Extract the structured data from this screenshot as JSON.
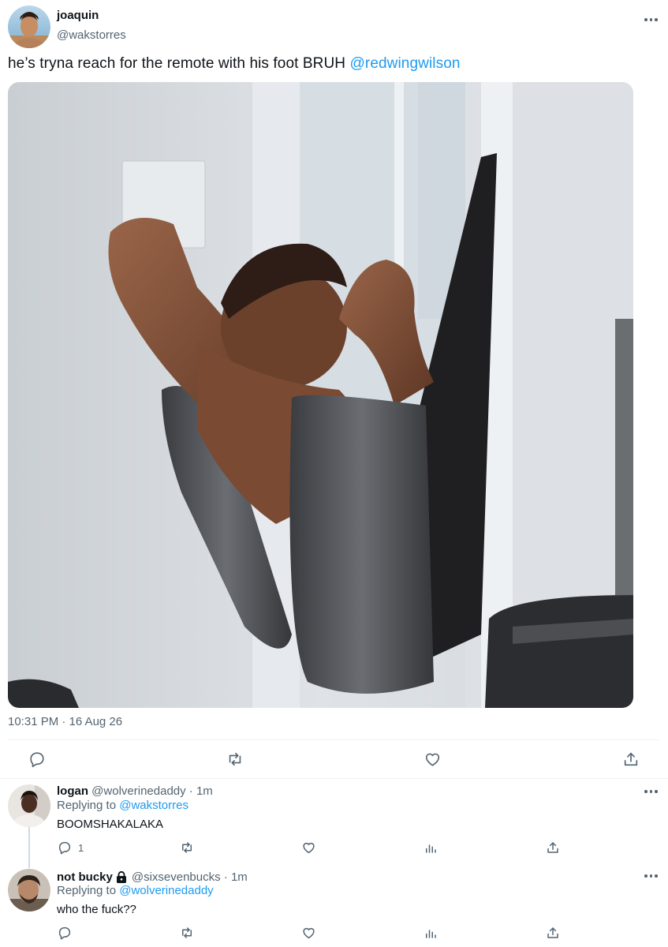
{
  "tweet": {
    "author_name": "joaquin",
    "author_handle": "@wakstorres",
    "text": "he’s tryna reach for the remote with his foot BRUH ",
    "mention": "@redwingwilson",
    "timestamp": "10:31 PM · 16 Aug 26"
  },
  "replies": [
    {
      "name": "logan",
      "handle_time": "@wolverinedaddy · 1m",
      "replying_label": "Replying to ",
      "replying_to": "@wakstorres",
      "text": "BOOMSHAKALAKA",
      "reply_count": "1"
    },
    {
      "name": "not bucky",
      "handle_time": "@sixsevenbucks · 1m",
      "replying_label": "Replying to ",
      "replying_to": "@wolverinedaddy",
      "text": "who the fuck??",
      "reply_count": ""
    }
  ],
  "icons": {
    "reply": "reply-icon",
    "retweet": "retweet-icon",
    "like": "heart-icon",
    "analytics": "analytics-icon",
    "share": "share-icon",
    "more": "more-icon",
    "lock": "lock-icon"
  },
  "colors": {
    "link": "#1d9bf0",
    "secondary_text": "#536471",
    "divider": "#eff3f4"
  }
}
